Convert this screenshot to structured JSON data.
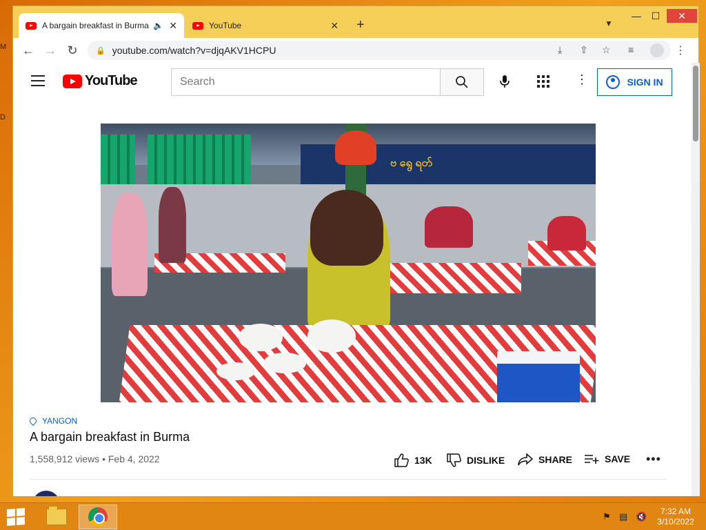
{
  "browser": {
    "tabs": [
      {
        "title": "A bargain breakfast in Burma",
        "active": true,
        "audio_icon": "speaker-icon",
        "close": "✕"
      },
      {
        "title": "YouTube",
        "active": false,
        "close": "✕"
      }
    ],
    "new_tab": "+",
    "window_controls": {
      "minimize": "—",
      "maximize": "☐",
      "close": "✕"
    },
    "url": "youtube.com/watch?v=djqAKV1HCPU"
  },
  "youtube": {
    "logo_text": "YouTube",
    "search_placeholder": "Search",
    "sign_in": "SIGN IN",
    "video": {
      "location": "YANGON",
      "title": "A bargain breakfast in Burma",
      "views_date": "1,558,912 views • Feb 4, 2022",
      "likes": "13K",
      "dislike": "DISLIKE",
      "share": "SHARE",
      "save": "SAVE"
    }
  },
  "taskbar": {
    "time": "7:32 AM",
    "date": "3/10/2022"
  },
  "colors": {
    "yt_red": "#ff0000",
    "link_blue": "#065fd4",
    "window_frame": "#f5cf58",
    "desktop": "#e88a12"
  }
}
